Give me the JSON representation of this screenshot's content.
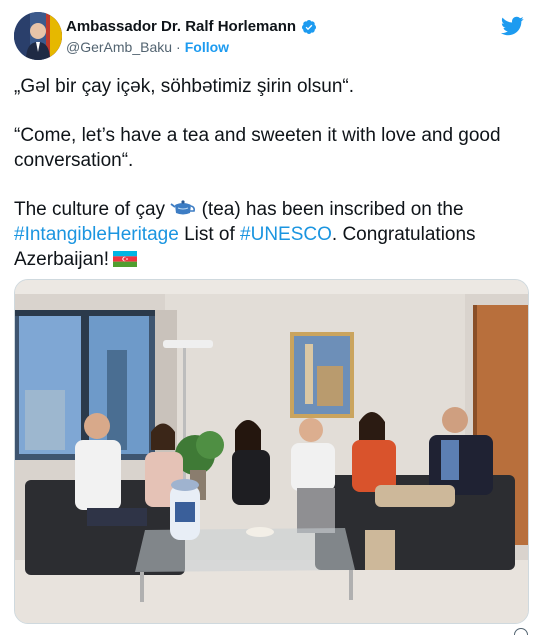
{
  "author": {
    "name": "Ambassador Dr. Ralf Horlemann",
    "handle": "@GerAmb_Baku",
    "separator": "·",
    "follow_label": "Follow"
  },
  "icons": {
    "verified": "verified-badge-icon",
    "brand": "twitter-bird-icon",
    "teapot": "teapot-emoji",
    "flag": "azerbaijan-flag-emoji"
  },
  "colors": {
    "link": "#1b95e0",
    "follow": "#1d9bf0",
    "text": "#0f1419",
    "muted": "#536471"
  },
  "tweet": {
    "line1": "„Gəl bir çay içək, söhbətimiz şirin olsun“.",
    "line2": "“Come, let’s have a tea and sweeten it with love and good conversation“.",
    "p3_a": "The culture of çay",
    "p3_b": " (tea)  has been inscribed on the",
    "hashtag1": "#IntangibleHeritage",
    "p3_c": " List of ",
    "hashtag2": "#UNESCO",
    "p3_d": ". Congratulations Azerbaijan!"
  }
}
